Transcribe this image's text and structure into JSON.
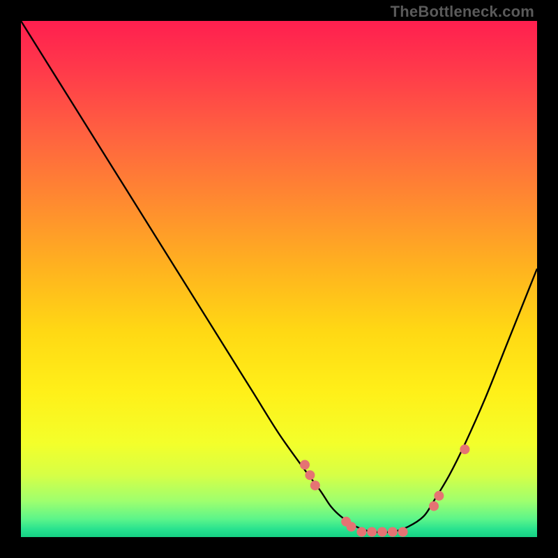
{
  "watermark": "TheBottleneck.com",
  "chart_data": {
    "type": "line",
    "title": "",
    "xlabel": "",
    "ylabel": "",
    "xlim": [
      0,
      100
    ],
    "ylim": [
      0,
      100
    ],
    "curve": {
      "x": [
        0,
        5,
        10,
        15,
        20,
        25,
        30,
        35,
        40,
        45,
        50,
        55,
        58,
        60,
        62,
        65,
        68,
        70,
        72,
        75,
        78,
        80,
        83,
        86,
        90,
        94,
        98,
        100
      ],
      "y": [
        100,
        92,
        84,
        76,
        68,
        60,
        52,
        44,
        36,
        28,
        20,
        13,
        9,
        6,
        4,
        2,
        1,
        1,
        1,
        2,
        4,
        7,
        12,
        18,
        27,
        37,
        47,
        52
      ]
    },
    "markers": {
      "x": [
        55,
        56,
        57,
        63,
        64,
        66,
        68,
        70,
        72,
        74,
        80,
        81,
        86
      ],
      "y": [
        14,
        12,
        10,
        3,
        2,
        1,
        1,
        1,
        1,
        1,
        6,
        8,
        17
      ]
    },
    "background_gradient": {
      "stops": [
        {
          "offset": 0.0,
          "color": "#ff1f4f"
        },
        {
          "offset": 0.1,
          "color": "#ff3b4a"
        },
        {
          "offset": 0.22,
          "color": "#ff6240"
        },
        {
          "offset": 0.35,
          "color": "#ff8a30"
        },
        {
          "offset": 0.48,
          "color": "#ffb31f"
        },
        {
          "offset": 0.6,
          "color": "#ffd814"
        },
        {
          "offset": 0.72,
          "color": "#fff019"
        },
        {
          "offset": 0.82,
          "color": "#f3ff2b"
        },
        {
          "offset": 0.88,
          "color": "#d6ff46"
        },
        {
          "offset": 0.93,
          "color": "#9fff6e"
        },
        {
          "offset": 0.965,
          "color": "#5cf58a"
        },
        {
          "offset": 0.985,
          "color": "#28e28f"
        },
        {
          "offset": 1.0,
          "color": "#15d183"
        }
      ]
    },
    "curve_color": "#000000",
    "marker_color": "#e57373",
    "marker_radius_px": 7
  }
}
